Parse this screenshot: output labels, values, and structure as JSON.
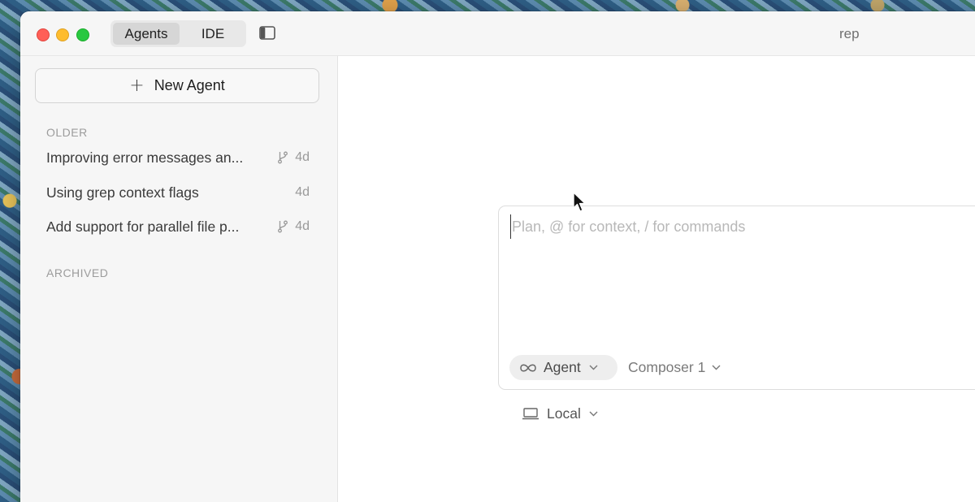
{
  "titlebar": {
    "tabs": [
      {
        "label": "Agents",
        "active": true
      },
      {
        "label": "IDE",
        "active": false
      }
    ],
    "window_title": "rep"
  },
  "sidebar": {
    "new_agent_label": "New Agent",
    "sections": {
      "older": "OLDER",
      "archived": "ARCHIVED"
    },
    "agents": [
      {
        "title": "Improving error messages an...",
        "age": "4d",
        "has_branch_icon": true
      },
      {
        "title": "Using grep context flags",
        "age": "4d",
        "has_branch_icon": false
      },
      {
        "title": "Add support for parallel file p...",
        "age": "4d",
        "has_branch_icon": true
      }
    ]
  },
  "composer": {
    "placeholder": "Plan, @ for context, / for commands",
    "value": "",
    "mode_label": "Agent",
    "model_label": "Composer 1",
    "location_label": "Local"
  },
  "colors": {
    "close": "#ff5f57",
    "minimize": "#febc2e",
    "zoom": "#28c840",
    "sidebar_bg": "#f6f6f6",
    "placeholder": "#b8b8b8"
  },
  "icons": {
    "new_agent": "plus-icon",
    "sidebar_toggle": "sidebar-toggle-icon",
    "branch": "git-branch-icon",
    "mode": "infinity-icon",
    "dropdown": "chevron-down-icon",
    "location": "laptop-icon",
    "pointer": "mouse-pointer-icon"
  }
}
